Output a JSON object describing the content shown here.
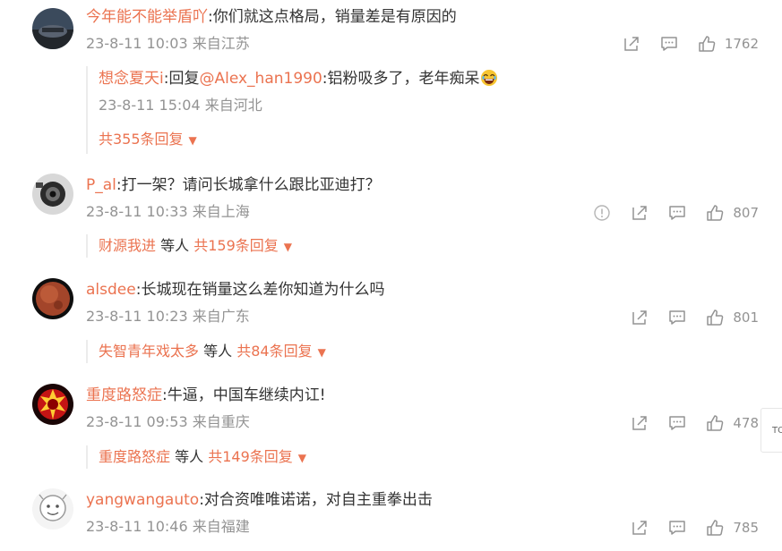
{
  "comments": [
    {
      "user": "今年能不能举盾吖",
      "text": ":你们就这点格局，销量差是有原因的",
      "meta": "23-8-11 10:03 来自江苏",
      "likes": "1762",
      "reply": {
        "user": "想念夏天i",
        "prefix": ":回复",
        "mention": "@Alex_han1990",
        "text": ":铝粉吸多了，老年痴呆",
        "meta": "23-8-11 15:04 来自河北"
      },
      "more": {
        "prefix": "",
        "suffix": "",
        "count": "共355条回复"
      }
    },
    {
      "user": "P_al",
      "text": ":打一架？请问长城拿什么跟比亚迪打？",
      "meta": "23-8-11 10:33 来自上海",
      "likes": "807",
      "more": {
        "prefix": "财源我进",
        "suffix": " 等人 ",
        "count": "共159条回复"
      }
    },
    {
      "user": "alsdee",
      "text": ":长城现在销量这么差你知道为什么吗",
      "meta": "23-8-11 10:23 来自广东",
      "likes": "801",
      "more": {
        "prefix": "失智青年戏太多",
        "suffix": " 等人 ",
        "count": "共84条回复"
      }
    },
    {
      "user": "重度路怒症",
      "text": ":牛逼，中国车继续内讧!",
      "meta": "23-8-11 09:53 来自重庆",
      "likes": "478",
      "more": {
        "prefix": "重度路怒症",
        "suffix": " 等人 ",
        "count": "共149条回复"
      }
    },
    {
      "user": "yangwangauto",
      "text": ":对合资唯唯诺诺，对自主重拳出击",
      "meta": "23-8-11 10:46 来自福建",
      "likes": "785"
    }
  ],
  "side_button_label": "TO",
  "icons": {
    "share": "share-icon",
    "comment": "comment-icon",
    "like": "like-icon",
    "report": "report-icon"
  },
  "colors": {
    "username": "#eb7350",
    "meta": "#939393",
    "text": "#333333"
  }
}
